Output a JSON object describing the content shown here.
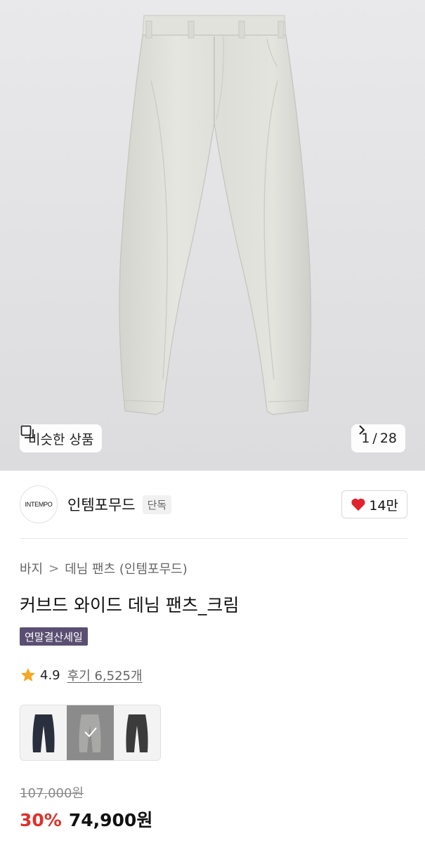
{
  "gallery": {
    "similar_label": "비슷한 상품",
    "current_page": "1",
    "total_pages": "28",
    "separator": "/"
  },
  "brand": {
    "logo_text": "INTEMPO",
    "name": "인템포무드",
    "tag": "단독",
    "likes": "14만"
  },
  "breadcrumb": {
    "category": "바지",
    "arrow": ">",
    "subcategory": "데님 팬츠 (인템포무드)"
  },
  "product": {
    "title": "커브드 와이드 데님 팬츠_크림",
    "badge": "연말결산세일",
    "rating": "4.9",
    "review_label": "후기 6,525개",
    "swatches": [
      {
        "color": "#2a2f3d",
        "selected": false
      },
      {
        "color": "#a8a8a6",
        "selected": true
      },
      {
        "color": "#3b3b3b",
        "selected": false
      }
    ],
    "original_price": "107,000원",
    "discount": "30%",
    "final_price": "74,900원"
  },
  "colors": {
    "sale_badge": "#5a4f72",
    "discount": "#e0302a",
    "heart": "#e0242b",
    "star": "#f5a623"
  }
}
